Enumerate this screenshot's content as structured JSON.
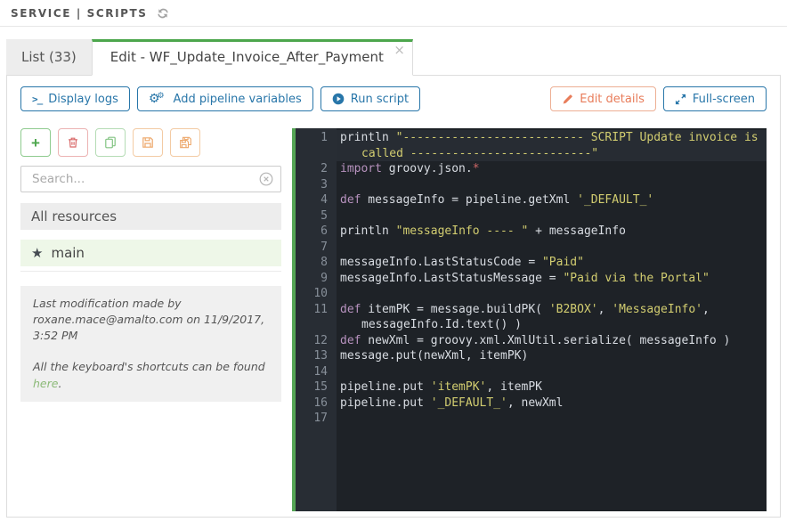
{
  "breadcrumb": {
    "text": "SERVICE | SCRIPTS"
  },
  "tabs": {
    "list_label": "List (33)",
    "edit_label": "Edit - WF_Update_Invoice_After_Payment",
    "close_glyph": "×"
  },
  "toolbar": {
    "display_logs": "Display logs",
    "add_pipeline_variables": "Add pipeline variables",
    "run_script": "Run script",
    "edit_details": "Edit details",
    "full_screen": "Full-screen"
  },
  "icons": {
    "terminal_glyph": ">_",
    "gear_glyph": "⚙",
    "star_glyph": "★",
    "plus_glyph": "+"
  },
  "sidebar": {
    "search_placeholder": "Search...",
    "all_resources_label": "All resources",
    "script_name": "main",
    "note_line1": "Last modification made by roxane.mace@amalto.com on 11/9/2017, 3:52 PM",
    "note_line2_prefix": "All the keyboard's shortcuts can be found ",
    "note_link_label": "here",
    "note_line2_suffix": "."
  },
  "editor": {
    "language": "groovy",
    "lines": [
      {
        "active": true,
        "tokens": [
          {
            "c": "p",
            "t": "println "
          },
          {
            "c": "s",
            "t": "\"-------------------------- SCRIPT Update invoice is called --------------------------\""
          }
        ]
      },
      {
        "tokens": [
          {
            "c": "k",
            "t": "import"
          },
          {
            "c": "p",
            "t": " groovy.json."
          },
          {
            "c": "r",
            "t": "*"
          }
        ]
      },
      {
        "tokens": []
      },
      {
        "tokens": [
          {
            "c": "k",
            "t": "def"
          },
          {
            "c": "p",
            "t": " messageInfo = pipeline.getXml "
          },
          {
            "c": "s",
            "t": "'_DEFAULT_'"
          }
        ]
      },
      {
        "tokens": []
      },
      {
        "tokens": [
          {
            "c": "p",
            "t": "println "
          },
          {
            "c": "s",
            "t": "\"messageInfo ---- \""
          },
          {
            "c": "p",
            "t": " + messageInfo"
          }
        ]
      },
      {
        "tokens": []
      },
      {
        "tokens": [
          {
            "c": "p",
            "t": "messageInfo.LastStatusCode = "
          },
          {
            "c": "s",
            "t": "\"Paid\""
          }
        ]
      },
      {
        "tokens": [
          {
            "c": "p",
            "t": "messageInfo.LastStatusMessage = "
          },
          {
            "c": "s",
            "t": "\"Paid via the Portal\""
          }
        ]
      },
      {
        "tokens": []
      },
      {
        "tokens": [
          {
            "c": "k",
            "t": "def"
          },
          {
            "c": "p",
            "t": " itemPK = message.buildPK( "
          },
          {
            "c": "s",
            "t": "'B2BOX'"
          },
          {
            "c": "p",
            "t": ", "
          },
          {
            "c": "s",
            "t": "'MessageInfo'"
          },
          {
            "c": "p",
            "t": ", messageInfo.Id.text() )"
          }
        ]
      },
      {
        "tokens": [
          {
            "c": "k",
            "t": "def"
          },
          {
            "c": "p",
            "t": " newXml = groovy.xml.XmlUtil.serialize( messageInfo )"
          }
        ]
      },
      {
        "tokens": [
          {
            "c": "p",
            "t": "message.put(newXml, itemPK)"
          }
        ]
      },
      {
        "tokens": []
      },
      {
        "tokens": [
          {
            "c": "p",
            "t": "pipeline.put "
          },
          {
            "c": "s",
            "t": "'itemPK'"
          },
          {
            "c": "p",
            "t": ", itemPK"
          }
        ]
      },
      {
        "tokens": [
          {
            "c": "p",
            "t": "pipeline.put "
          },
          {
            "c": "s",
            "t": "'_DEFAULT_'"
          },
          {
            "c": "p",
            "t": ", newXml"
          }
        ]
      },
      {
        "tokens": []
      }
    ]
  },
  "colors": {
    "accent_blue": "#2876a9",
    "accent_green": "#4ca64c",
    "accent_orange": "#e87c5a",
    "danger_red": "#d96969",
    "editor_bg": "#1e2227",
    "editor_gutter_bg": "#282d34",
    "editor_active_line": "#272c33",
    "syntax_keyword": "#b792be",
    "syntax_string": "#d2cd70",
    "syntax_red": "#cc6666",
    "link_green": "#8cba78"
  }
}
